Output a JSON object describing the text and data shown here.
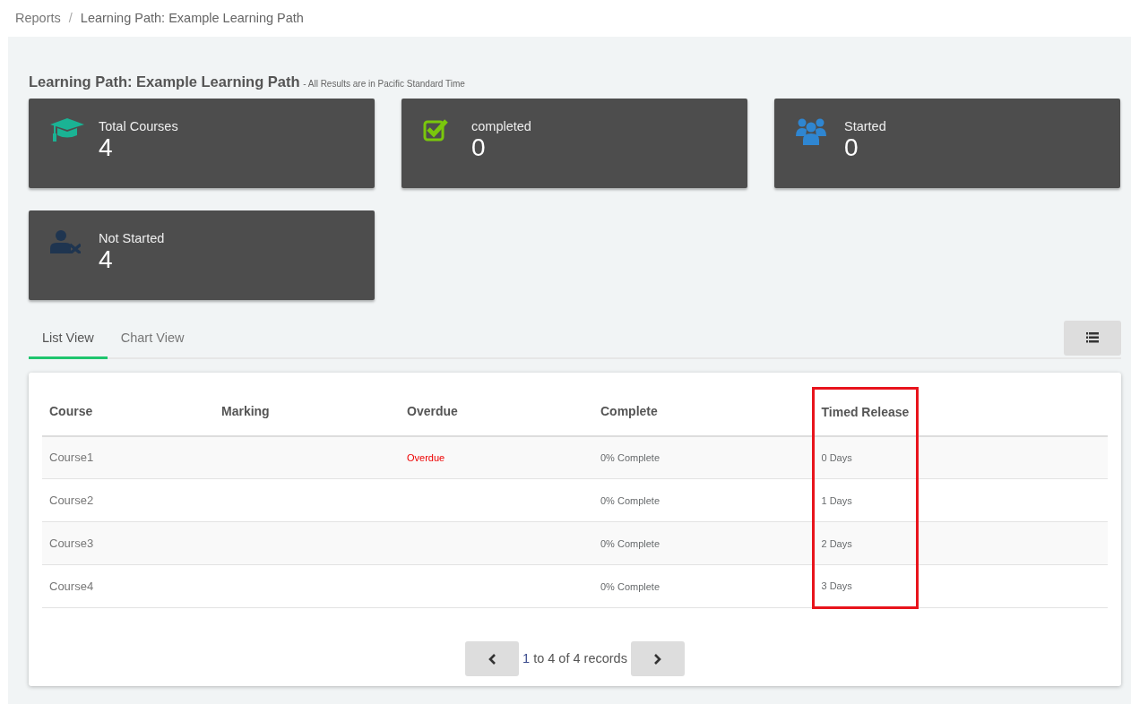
{
  "breadcrumb": [
    {
      "label": "Reports",
      "current": false
    },
    {
      "label": "Learning Path: Example Learning Path",
      "current": true
    }
  ],
  "breadcrumb_separator": "/",
  "report": {
    "title": "Learning Path: Example Learning Path",
    "subtitle": "- All Results are in Pacific Standard Time"
  },
  "stats": [
    {
      "kind": "courses",
      "label": "Total Courses",
      "value": "4",
      "color": "#1ab394"
    },
    {
      "kind": "completed",
      "label": "completed",
      "value": "0",
      "color": "#7ac70c"
    },
    {
      "kind": "started",
      "label": "Started",
      "value": "0",
      "color": "#2f86d1"
    },
    {
      "kind": "not_started",
      "label": "Not Started",
      "value": "4",
      "color": "#1f3550"
    }
  ],
  "tabs": [
    {
      "label": "List View",
      "selected": true
    },
    {
      "label": "Chart View",
      "selected": false
    }
  ],
  "table": {
    "columns": [
      {
        "label": "Course",
        "highlighted": false
      },
      {
        "label": "Marking",
        "highlighted": false
      },
      {
        "label": "Overdue",
        "highlighted": false
      },
      {
        "label": "Complete",
        "highlighted": false
      },
      {
        "label": "Timed Release",
        "highlighted": true
      }
    ],
    "rows": [
      {
        "course": "Course1",
        "overdue": "Overdue",
        "complete": "0% Complete",
        "timed_release": "0 Days"
      },
      {
        "course": "Course2",
        "complete": "0% Complete",
        "timed_release": "1 Days"
      },
      {
        "course": "Course3",
        "complete": "0% Complete",
        "timed_release": "2 Days"
      },
      {
        "course": "Course4",
        "complete": "0% Complete",
        "timed_release": "3 Days"
      }
    ]
  },
  "pagination": {
    "first": "1",
    "rest": " to 4 of 4 records"
  }
}
